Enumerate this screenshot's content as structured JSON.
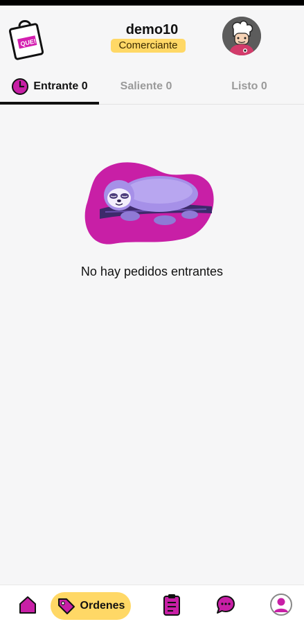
{
  "header": {
    "user_name": "demo10",
    "role": "Comerciante",
    "logo_text": "QUE!"
  },
  "tabs": [
    {
      "label": "Entrante 0",
      "active": true,
      "icon": "clock-icon"
    },
    {
      "label": "Saliente 0",
      "active": false
    },
    {
      "label": "Listo 0",
      "active": false
    }
  ],
  "empty_state": {
    "message": "No hay pedidos entrantes",
    "illustration": "sleeping-sloth"
  },
  "bottom_nav": {
    "items": [
      {
        "name": "home",
        "icon": "home-icon"
      },
      {
        "name": "orders",
        "icon": "tag-icon",
        "label": "Ordenes",
        "active": true
      },
      {
        "name": "clipboard",
        "icon": "clipboard-icon"
      },
      {
        "name": "chat",
        "icon": "chat-icon"
      },
      {
        "name": "profile",
        "icon": "profile-icon"
      }
    ]
  },
  "colors": {
    "accent": "#c81fa6",
    "highlight": "#ffd866",
    "text": "#111111",
    "muted": "#9a9a9a"
  }
}
